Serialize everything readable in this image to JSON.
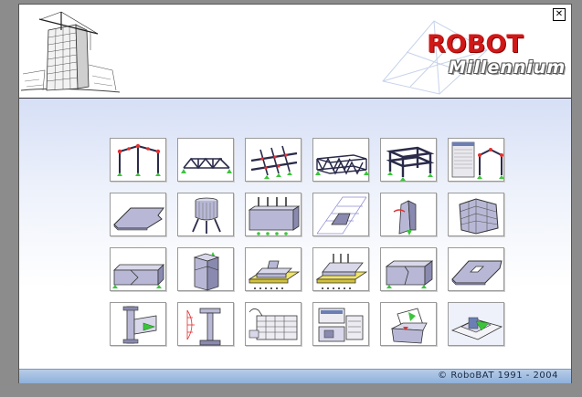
{
  "header": {
    "logo_brand": "ROBOT",
    "logo_product": "Millennium",
    "close_symbol": "✕"
  },
  "footer": {
    "copyright": "© RoboBAT 1991 - 2004"
  },
  "colors": {
    "logo_red": "#d01818",
    "footer_bar": "#9fbde3",
    "icon_green": "#3cc43c",
    "icon_red": "#e23030",
    "icon_steel": "#b8b8d6"
  },
  "modules": [
    {
      "icon": "frame-2d-icon"
    },
    {
      "icon": "truss-2d-icon"
    },
    {
      "icon": "grillage-icon"
    },
    {
      "icon": "truss-3d-icon"
    },
    {
      "icon": "frame-3d-icon"
    },
    {
      "icon": "frame-with-table-icon"
    },
    {
      "icon": "plate-design-icon"
    },
    {
      "icon": "axisymmetric-tank-icon"
    },
    {
      "icon": "shell-design-icon"
    },
    {
      "icon": "section-design-icon"
    },
    {
      "icon": "volumetric-structure-icon"
    },
    {
      "icon": "stress-analysis-icon"
    },
    {
      "icon": "rc-beam-icon"
    },
    {
      "icon": "rc-column-icon"
    },
    {
      "icon": "spread-footing-icon"
    },
    {
      "icon": "continuous-footing-icon"
    },
    {
      "icon": "rc-wall-icon"
    },
    {
      "icon": "rc-slab-icon"
    },
    {
      "icon": "steel-connection-icon"
    },
    {
      "icon": "timber-section-icon"
    },
    {
      "icon": "steel-design-icon"
    },
    {
      "icon": "workshop-drawing-icon"
    },
    {
      "icon": "mail-box-icon"
    },
    {
      "icon": "open-project-icon"
    }
  ]
}
